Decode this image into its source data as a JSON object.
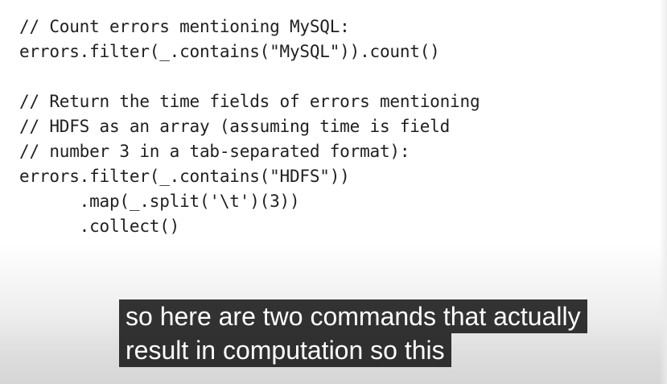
{
  "code": {
    "lines": [
      "// Count errors mentioning MySQL:",
      "errors.filter(_.contains(\"MySQL\")).count()",
      "",
      "// Return the time fields of errors mentioning",
      "// HDFS as an array (assuming time is field",
      "// number 3 in a tab-separated format):",
      "errors.filter(_.contains(\"HDFS\"))",
      "      .map(_.split('\\t')(3))",
      "      .collect()"
    ]
  },
  "caption": {
    "line1": "so here are two commands that actually",
    "line2": "result in computation so this"
  }
}
